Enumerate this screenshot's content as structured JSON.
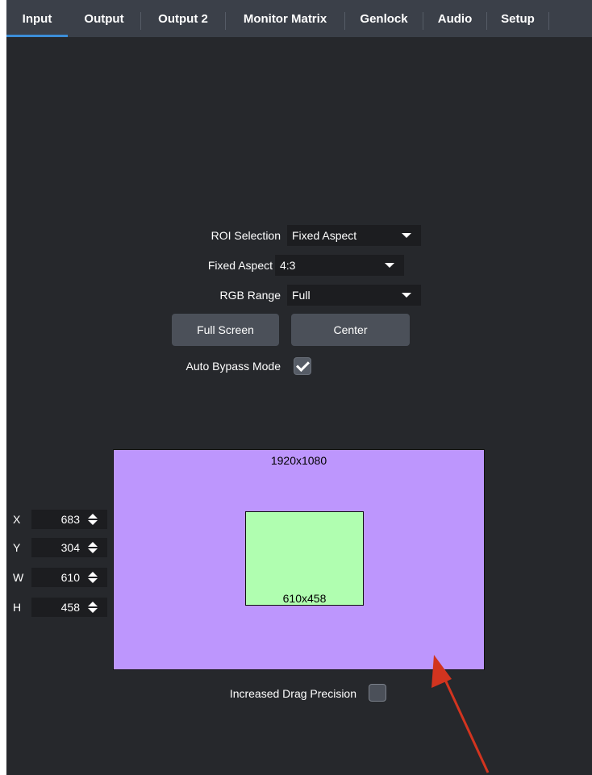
{
  "tabs": [
    {
      "label": "Input",
      "active": true
    },
    {
      "label": "Output",
      "active": false
    },
    {
      "label": "Output 2",
      "active": false
    },
    {
      "label": "Monitor Matrix",
      "active": false
    },
    {
      "label": "Genlock",
      "active": false
    },
    {
      "label": "Audio",
      "active": false
    },
    {
      "label": "Setup",
      "active": false
    }
  ],
  "roi_selection": {
    "label": "ROI Selection",
    "value": "Fixed Aspect"
  },
  "fixed_aspect": {
    "label": "Fixed Aspect",
    "value": "4:3"
  },
  "rgb_range": {
    "label": "RGB Range",
    "value": "Full"
  },
  "buttons": {
    "full_screen": "Full Screen",
    "center": "Center"
  },
  "auto_bypass": {
    "label": "Auto Bypass Mode",
    "checked": true
  },
  "coords": [
    {
      "label": "X",
      "value": "683"
    },
    {
      "label": "Y",
      "value": "304"
    },
    {
      "label": "W",
      "value": "610"
    },
    {
      "label": "H",
      "value": "458"
    }
  ],
  "canvas": {
    "source_resolution": "1920x1080",
    "roi_resolution": "610x458"
  },
  "drag_precision": {
    "label": "Increased Drag Precision",
    "checked": false
  },
  "colors": {
    "background": "#26282c",
    "tab_bar": "#3b4049",
    "tab_active_underline": "#3c8ed8",
    "source_area": "#bd96fd",
    "roi_area": "#b0feb0",
    "annotation_arrow": "#d2341f"
  }
}
